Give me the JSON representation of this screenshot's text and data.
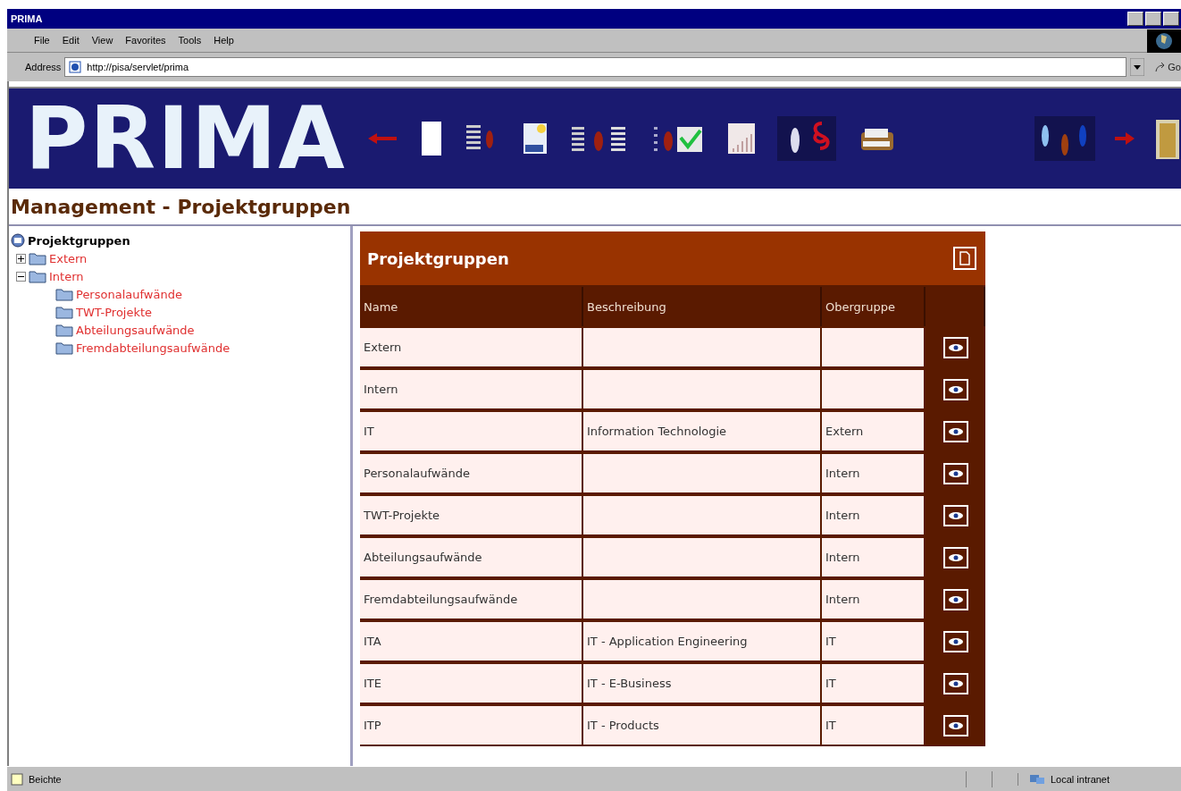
{
  "window": {
    "title": "PRIMA"
  },
  "menu": [
    "File",
    "Edit",
    "View",
    "Favorites",
    "Tools",
    "Help"
  ],
  "address_bar": {
    "label": "Address",
    "value": "http://pisa/servlet/prima",
    "go": "Go"
  },
  "banner": {
    "logo": "PRIMA"
  },
  "page_title": "Management - Projektgruppen",
  "tree": {
    "root": "Projektgruppen",
    "children": [
      {
        "label": "Extern",
        "expanded": false
      },
      {
        "label": "Intern",
        "expanded": true,
        "children": [
          {
            "label": "Personalaufwände"
          },
          {
            "label": "TWT-Projekte"
          },
          {
            "label": "Abteilungsaufwände"
          },
          {
            "label": "Fremdabteilungsaufwände"
          }
        ]
      }
    ]
  },
  "panel": {
    "title": "Projektgruppen",
    "columns": [
      "Name",
      "Beschreibung",
      "Obergruppe"
    ],
    "rows": [
      {
        "name": "Extern"
      },
      {
        "name": "Intern"
      },
      {
        "name": "IT",
        "description": "Information Technologie",
        "parent": "Extern"
      },
      {
        "name": "Personalaufwände",
        "parent": "Intern"
      },
      {
        "name": "TWT-Projekte",
        "parent": "Intern"
      },
      {
        "name": "Abteilungsaufwände",
        "parent": "Intern"
      },
      {
        "name": "Fremdabteilungsaufwände",
        "parent": "Intern"
      },
      {
        "name": "ITA",
        "description": "IT - Application Engineering",
        "parent": "IT"
      },
      {
        "name": "ITE",
        "description": "IT - E-Business",
        "parent": "IT"
      },
      {
        "name": "ITP",
        "description": "IT - Products",
        "parent": "IT"
      }
    ]
  },
  "status_bar": {
    "text": "Beichte",
    "zone": "Local intranet"
  }
}
